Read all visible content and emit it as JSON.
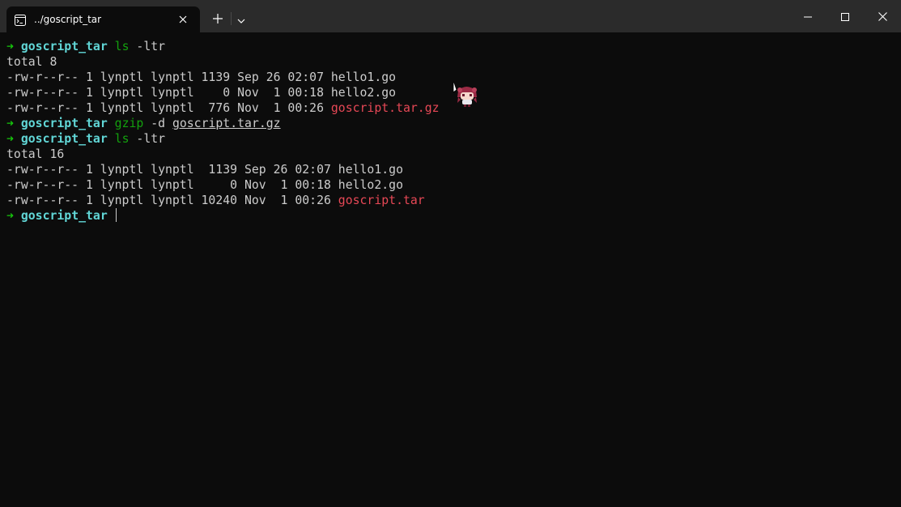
{
  "window": {
    "tab_title": "../goscript_tar",
    "icons": {
      "tab": "terminal-icon",
      "tab_close": "close-icon",
      "new_tab": "plus-icon",
      "dropdown": "chevron-down-icon",
      "minimize": "minimize-icon",
      "maximize": "maximize-icon",
      "close": "close-icon"
    }
  },
  "colors": {
    "background": "#0c0c0c",
    "titlebar": "#2b2b2b",
    "prompt_arrow": "#16c60c",
    "prompt_dir": "#61d6d6",
    "command": "#13a10e",
    "text": "#cccccc",
    "archive": "#e74856"
  },
  "terminal": {
    "prompt_arrow": "➜",
    "cwd": "goscript_tar",
    "cmd1": {
      "program": "ls",
      "args": " -ltr"
    },
    "out1": {
      "total": "total 8",
      "rows": [
        {
          "meta": "-rw-r--r-- 1 lynptl lynptl 1139 Sep 26 02:07 ",
          "name": "hello1.go"
        },
        {
          "meta": "-rw-r--r-- 1 lynptl lynptl    0 Nov  1 00:18 ",
          "name": "hello2.go"
        },
        {
          "meta": "-rw-r--r-- 1 lynptl lynptl  776 Nov  1 00:26 ",
          "name": "goscript.tar.gz"
        }
      ]
    },
    "cmd2": {
      "program": "gzip",
      "flag": " -d ",
      "arg": "goscript.tar.gz"
    },
    "cmd3": {
      "program": "ls",
      "args": " -ltr"
    },
    "out2": {
      "total": "total 16",
      "rows": [
        {
          "meta": "-rw-r--r-- 1 lynptl lynptl  1139 Sep 26 02:07 ",
          "name": "hello1.go"
        },
        {
          "meta": "-rw-r--r-- 1 lynptl lynptl     0 Nov  1 00:18 ",
          "name": "hello2.go"
        },
        {
          "meta": "-rw-r--r-- 1 lynptl lynptl 10240 Nov  1 00:26 ",
          "name": "goscript.tar"
        }
      ]
    }
  }
}
